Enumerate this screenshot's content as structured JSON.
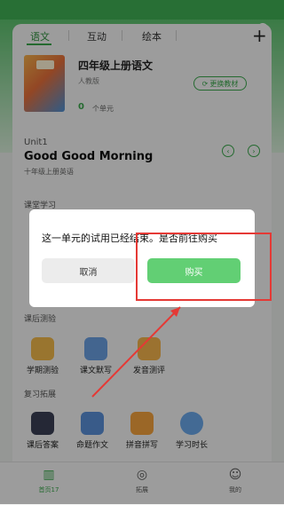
{
  "tabs": [
    "语文",
    "互动",
    "绘本"
  ],
  "book": {
    "title": "四年级上册语文",
    "publisher": "人教版",
    "unit_count": "0",
    "unit_label": "个单元",
    "switch_label": "更换教材"
  },
  "unit": {
    "number": "Unit1",
    "name": "Good Good Morning",
    "book": "十年级上册英语"
  },
  "sections": {
    "class_study": "课堂学习",
    "after_class_test": "课后测验",
    "review": "复习拓展"
  },
  "test_tools": [
    {
      "label": "学期测验",
      "icon": "exam-icon"
    },
    {
      "label": "课文默写",
      "icon": "book-icon"
    },
    {
      "label": "发音测评",
      "icon": "pronunciation-icon"
    }
  ],
  "review_tools": [
    {
      "label": "课后答案",
      "icon": "calendar-check-icon"
    },
    {
      "label": "命题作文",
      "icon": "composition-icon"
    },
    {
      "label": "拼音拼写",
      "icon": "pinyin-icon"
    },
    {
      "label": "学习时长",
      "icon": "alarm-clock-icon"
    }
  ],
  "bottom_nav": [
    {
      "label": "首页17",
      "icon": "book-open-icon",
      "active": true
    },
    {
      "label": "拓展",
      "icon": "compass-icon",
      "active": false
    },
    {
      "label": "我的",
      "icon": "smile-icon",
      "active": false
    }
  ],
  "dialog": {
    "message": "这一单元的试用已经结束。是否前往购买",
    "cancel_label": "取消",
    "buy_label": "购买"
  },
  "colors": {
    "accent": "#3aa64c",
    "buy_button": "#62cf74",
    "annotation": "#e53935"
  }
}
